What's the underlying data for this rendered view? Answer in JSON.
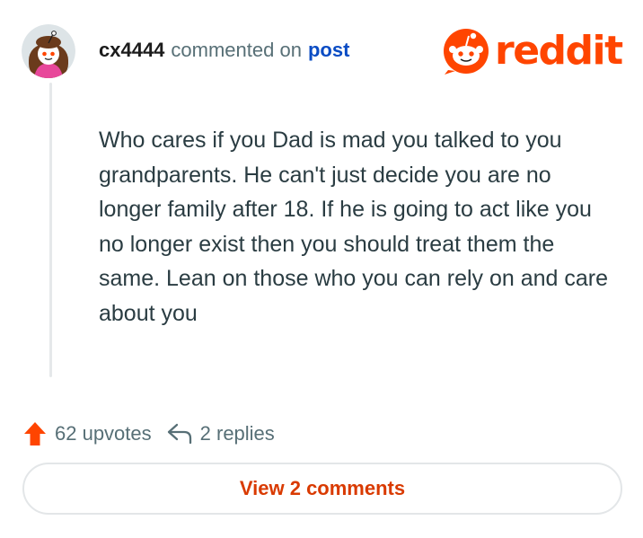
{
  "comment": {
    "username": "cx4444",
    "action_text": "commented on",
    "post_link_label": "post",
    "body": "Who cares if you Dad is mad you talked to you grandparents. He can't just decide you are no longer family after 18. If he is going to act like you no longer exist then you should treat them the same. Lean on those who you can rely on and care about you",
    "avatar_icon": "snoo-avatar-icon"
  },
  "brand": {
    "logo_icon": "reddit-snoo-icon",
    "wordmark": "reddit",
    "color": "#ff4500"
  },
  "actions": {
    "upvote_icon": "upvote-arrow-icon",
    "upvotes_label": "62 upvotes",
    "reply_icon": "reply-arrow-icon",
    "replies_label": "2 replies"
  },
  "footer": {
    "view_comments_label": "View 2 comments",
    "accent_color": "#d93a00"
  }
}
